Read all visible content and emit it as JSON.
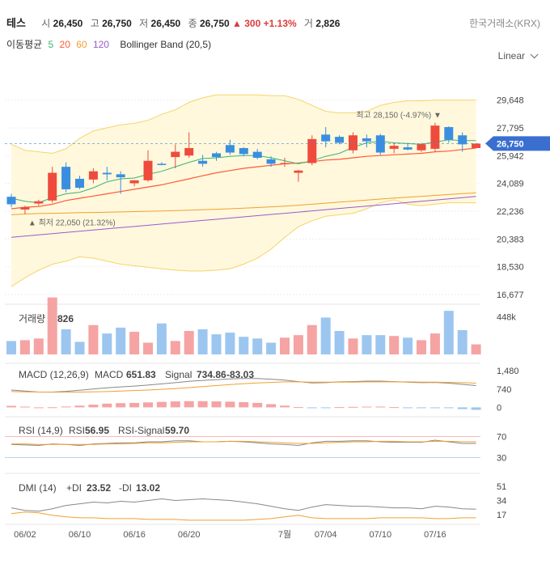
{
  "header": {
    "name": "테스",
    "open_label": "시",
    "open": "26,450",
    "high_label": "고",
    "high": "26,750",
    "low_label": "저",
    "low": "26,450",
    "close_label": "종",
    "close": "26,750",
    "change": "300",
    "change_pct": "+1.13%",
    "volume_label": "거",
    "volume": "2,826",
    "exchange": "한국거래소(KRX)"
  },
  "indicators": {
    "ma_label": "이동평균",
    "ma_periods": [
      "5",
      "20",
      "60",
      "120"
    ],
    "ma_colors": [
      "#3cb371",
      "#ff5a36",
      "#f0a030",
      "#9b59d0"
    ],
    "bollinger_label": "Bollinger Band (20,5)"
  },
  "scale": {
    "mode": "Linear"
  },
  "colors": {
    "up": "#ee4b3d",
    "down": "#3a8ee0",
    "band_fill": "#fff8dc",
    "band_line": "#f5d46a"
  },
  "chart_data": [
    {
      "type": "candlestick",
      "y_ticks": [
        "29,648",
        "27,795",
        "25,942",
        "24,089",
        "22,236",
        "20,383",
        "18,530",
        "16,677"
      ],
      "ylim": [
        16677,
        31200
      ],
      "x_ticks": [
        "06/02",
        "06/10",
        "06/16",
        "06/20",
        "7월",
        "07/04",
        "07/10",
        "07/16"
      ],
      "x_tick_index": [
        1,
        5,
        9,
        13,
        20,
        23,
        27,
        31
      ],
      "current_price_label": "26,750",
      "current_price": 26750,
      "max_label": "최고 28,150 (-4.97%)",
      "max_index": 31,
      "max_price": 28150,
      "min_label": "최저 22,050 (21.32%)",
      "min_index": 1,
      "min_price": 22050,
      "candles": [
        [
          23200,
          23400,
          22500,
          22700
        ],
        [
          22350,
          22600,
          22050,
          22500
        ],
        [
          22750,
          23000,
          22600,
          22900
        ],
        [
          22950,
          25200,
          22800,
          24800
        ],
        [
          25200,
          25500,
          23500,
          23700
        ],
        [
          24400,
          24600,
          23700,
          23800
        ],
        [
          24350,
          25100,
          24100,
          24900
        ],
        [
          24800,
          25200,
          24300,
          24700
        ],
        [
          24700,
          24900,
          23400,
          24500
        ],
        [
          24100,
          24300,
          23900,
          24300
        ],
        [
          24300,
          26300,
          24200,
          25600
        ],
        [
          25400,
          25500,
          25300,
          25350
        ],
        [
          25850,
          26700,
          25100,
          26200
        ],
        [
          25950,
          27500,
          25800,
          26450
        ],
        [
          25600,
          26000,
          25200,
          25400
        ],
        [
          26100,
          26200,
          25600,
          25850
        ],
        [
          26650,
          27000,
          26000,
          26150
        ],
        [
          26450,
          26500,
          25900,
          26050
        ],
        [
          26200,
          26400,
          25700,
          25800
        ],
        [
          25700,
          25900,
          25200,
          25400
        ],
        [
          25450,
          25800,
          25200,
          25450
        ],
        [
          24800,
          25000,
          24200,
          24950
        ],
        [
          25450,
          27300,
          25300,
          27050
        ],
        [
          27350,
          27850,
          26500,
          26900
        ],
        [
          27200,
          27300,
          26700,
          26800
        ],
        [
          26300,
          27500,
          26100,
          27300
        ],
        [
          27100,
          27350,
          26500,
          26900
        ],
        [
          27300,
          27400,
          26000,
          26150
        ],
        [
          26400,
          26800,
          26100,
          26600
        ],
        [
          26500,
          26800,
          26300,
          26350
        ],
        [
          26300,
          26800,
          26200,
          26700
        ],
        [
          26400,
          28150,
          26200,
          27950
        ],
        [
          27850,
          27900,
          26800,
          27000
        ],
        [
          27300,
          27500,
          26200,
          26700
        ],
        [
          26450,
          26750,
          26450,
          26750
        ]
      ],
      "ma5": [
        23100,
        22900,
        22800,
        23150,
        23400,
        23500,
        23800,
        24200,
        24400,
        24450,
        24700,
        24900,
        25200,
        25500,
        25750,
        25800,
        25900,
        25950,
        25950,
        25800,
        25600,
        25400,
        25600,
        25900,
        26100,
        26500,
        26800,
        26900,
        26800,
        26750,
        26700,
        26850,
        27000,
        26950,
        26950
      ],
      "ma20": [
        22400,
        22500,
        22550,
        22700,
        22950,
        23100,
        23250,
        23400,
        23550,
        23700,
        23850,
        24000,
        24200,
        24400,
        24600,
        24800,
        24950,
        25100,
        25200,
        25300,
        25400,
        25450,
        25550,
        25650,
        25700,
        25800,
        25900,
        25950,
        26000,
        26050,
        26100,
        26200,
        26250,
        26350,
        26450
      ],
      "ma60": [
        22000,
        22050,
        22080,
        22100,
        22120,
        22140,
        22150,
        22170,
        22190,
        22210,
        22230,
        22250,
        22280,
        22310,
        22340,
        22370,
        22400,
        22440,
        22480,
        22530,
        22580,
        22640,
        22700,
        22770,
        22840,
        22910,
        22980,
        23050,
        23110,
        23170,
        23230,
        23290,
        23350,
        23410,
        23460
      ],
      "ma120": [
        20500,
        20580,
        20660,
        20740,
        20820,
        20900,
        20980,
        21060,
        21140,
        21220,
        21300,
        21380,
        21460,
        21540,
        21620,
        21700,
        21780,
        21860,
        21940,
        22020,
        22100,
        22180,
        22260,
        22340,
        22420,
        22500,
        22580,
        22660,
        22740,
        22820,
        22900,
        22980,
        23060,
        23140,
        23220
      ],
      "bb_upper": [
        26700,
        26300,
        26200,
        26100,
        26400,
        27100,
        27600,
        27800,
        28000,
        28100,
        28300,
        28700,
        29000,
        29500,
        29800,
        30000,
        30000,
        30000,
        30000,
        29950,
        29950,
        29700,
        29300,
        28900,
        28800,
        28800,
        28900,
        29300,
        29500,
        29600,
        29600,
        29650,
        29650,
        29650,
        29650
      ],
      "bb_lower": [
        17200,
        17800,
        18300,
        18700,
        18900,
        19200,
        19100,
        18900,
        18700,
        18600,
        18500,
        18400,
        18300,
        18250,
        18250,
        18300,
        18400,
        18700,
        19100,
        19700,
        20500,
        21200,
        21600,
        21900,
        22000,
        22100,
        22400,
        22800,
        23000,
        22700,
        22600,
        22700,
        22800,
        22800,
        22800
      ]
    },
    {
      "type": "bar",
      "label": "거래량",
      "value_label": "2,826",
      "y_ticks": [
        "448k"
      ],
      "ylim": [
        0,
        560
      ],
      "values": [
        160,
        170,
        190,
        680,
        300,
        150,
        350,
        250,
        320,
        270,
        140,
        370,
        160,
        280,
        300,
        240,
        260,
        210,
        190,
        140,
        200,
        230,
        350,
        440,
        280,
        190,
        230,
        230,
        220,
        200,
        170,
        250,
        520,
        290,
        120
      ]
    },
    {
      "type": "line",
      "label": "MACD (12,26,9)",
      "macd_label": "MACD",
      "macd_value": "651.83",
      "signal_label": "Signal",
      "signal_value": "734.86",
      "hist_value": "-83.03",
      "y_ticks": [
        "1,480",
        "740",
        "0"
      ],
      "ylim": [
        -150,
        1650
      ],
      "macd": [
        700,
        660,
        620,
        620,
        650,
        690,
        740,
        790,
        830,
        860,
        900,
        950,
        1000,
        1050,
        1090,
        1120,
        1150,
        1170,
        1170,
        1140,
        1100,
        1040,
        990,
        1000,
        1030,
        1040,
        1060,
        1060,
        1040,
        1020,
        1000,
        1010,
        980,
        930,
        880
      ],
      "signal": [
        640,
        630,
        620,
        615,
        615,
        620,
        630,
        640,
        660,
        680,
        700,
        730,
        760,
        800,
        840,
        880,
        920,
        960,
        990,
        1010,
        1030,
        1030,
        1020,
        1020,
        1020,
        1020,
        1030,
        1030,
        1030,
        1030,
        1020,
        1020,
        1010,
        1000,
        980
      ],
      "hist": [
        60,
        30,
        0,
        5,
        35,
        70,
        110,
        150,
        170,
        180,
        200,
        220,
        240,
        250,
        250,
        240,
        230,
        210,
        180,
        130,
        70,
        10,
        -30,
        -20,
        10,
        20,
        30,
        30,
        10,
        -10,
        -20,
        -10,
        -30,
        -70,
        -100
      ]
    },
    {
      "type": "line",
      "label": "RSI (14,9)",
      "rsi_label": "RSI",
      "rsi_value": "56.95",
      "signal_label": "RSI-Signal",
      "signal_value": "59.70",
      "y_ticks": [
        "70",
        "30"
      ],
      "ylim": [
        0,
        100
      ],
      "rsi": [
        55,
        54,
        53,
        56,
        55,
        53,
        56,
        57,
        58,
        58,
        60,
        60,
        62,
        62,
        60,
        60,
        61,
        60,
        58,
        56,
        55,
        53,
        58,
        61,
        61,
        62,
        62,
        60,
        59,
        59,
        59,
        63,
        60,
        57,
        57
      ],
      "signal": [
        56,
        56,
        55,
        55,
        55,
        55,
        55,
        56,
        56,
        57,
        58,
        58,
        59,
        60,
        60,
        60,
        61,
        61,
        60,
        59,
        58,
        57,
        57,
        58,
        59,
        60,
        60,
        61,
        61,
        60,
        60,
        61,
        61,
        60,
        60
      ]
    },
    {
      "type": "line",
      "label": "DMI (14)",
      "pdi_label": "+DI",
      "pdi_value": "23.52",
      "mdi_label": "-DI",
      "mdi_value": "13.02",
      "y_ticks": [
        "51",
        "34",
        "17"
      ],
      "ylim": [
        5,
        62
      ],
      "pdi": [
        25,
        22,
        21,
        24,
        28,
        30,
        32,
        31,
        33,
        32,
        34,
        36,
        34,
        35,
        36,
        35,
        34,
        32,
        30,
        27,
        24,
        22,
        26,
        29,
        28,
        27,
        27,
        26,
        25,
        25,
        24,
        27,
        26,
        24,
        23.5
      ],
      "mdi": [
        18,
        20,
        19,
        16,
        14,
        13,
        13,
        12,
        12,
        12,
        11,
        11,
        11,
        10,
        10,
        10,
        10,
        10,
        11,
        12,
        14,
        16,
        13,
        12,
        12,
        12,
        12,
        13,
        13,
        13,
        13,
        12,
        12,
        13,
        13
      ]
    }
  ]
}
